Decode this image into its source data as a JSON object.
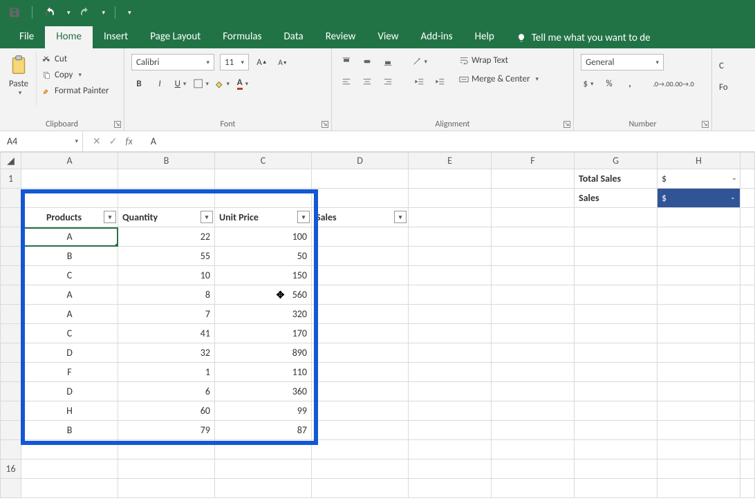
{
  "qat": {
    "save": "Save",
    "undo": "Undo",
    "redo": "Redo"
  },
  "menu": {
    "file": "File",
    "home": "Home",
    "insert": "Insert",
    "page_layout": "Page Layout",
    "formulas": "Formulas",
    "data": "Data",
    "review": "Review",
    "view": "View",
    "add_ins": "Add-ins",
    "help": "Help",
    "tellme": "Tell me what you want to de"
  },
  "ribbon": {
    "clipboard": {
      "paste": "Paste",
      "cut": "Cut",
      "copy": "Copy",
      "format_painter": "Format Painter",
      "group": "Clipboard"
    },
    "font": {
      "name": "Calibri",
      "size": "11",
      "group": "Font"
    },
    "alignment": {
      "wrap": "Wrap Text",
      "merge": "Merge & Center",
      "group": "Alignment"
    },
    "number": {
      "format": "General",
      "group": "Number",
      "cells_hint": "C",
      "format_hint": "Fo"
    }
  },
  "formula_bar": {
    "cell_ref": "A4",
    "value": "A"
  },
  "columns": [
    "A",
    "B",
    "C",
    "D",
    "E",
    "F",
    "G",
    "H"
  ],
  "labels": {
    "total_sales": "Total Sales",
    "sales": "Sales",
    "dollar": "$",
    "dash": "-"
  },
  "table": {
    "headers": {
      "products": "Products",
      "quantity": "Quantity",
      "unit_price": "Unit Price",
      "sales": "Sales"
    },
    "rows": [
      {
        "p": "A",
        "q": 22,
        "u": 100
      },
      {
        "p": "B",
        "q": 55,
        "u": 50
      },
      {
        "p": "C",
        "q": 10,
        "u": 150
      },
      {
        "p": "A",
        "q": 8,
        "u": 560,
        "cursor": true
      },
      {
        "p": "A",
        "q": 7,
        "u": 320
      },
      {
        "p": "C",
        "q": 41,
        "u": 170
      },
      {
        "p": "D",
        "q": 32,
        "u": 890
      },
      {
        "p": "F",
        "q": 1,
        "u": 110
      },
      {
        "p": "D",
        "q": 6,
        "u": 360
      },
      {
        "p": "H",
        "q": 60,
        "u": 99
      },
      {
        "p": "B",
        "q": 79,
        "u": 87
      }
    ]
  },
  "row_numbers": [
    "1",
    "",
    "",
    "",
    "",
    "",
    "",
    "",
    "",
    "",
    "",
    "",
    "",
    "",
    "",
    "16"
  ]
}
